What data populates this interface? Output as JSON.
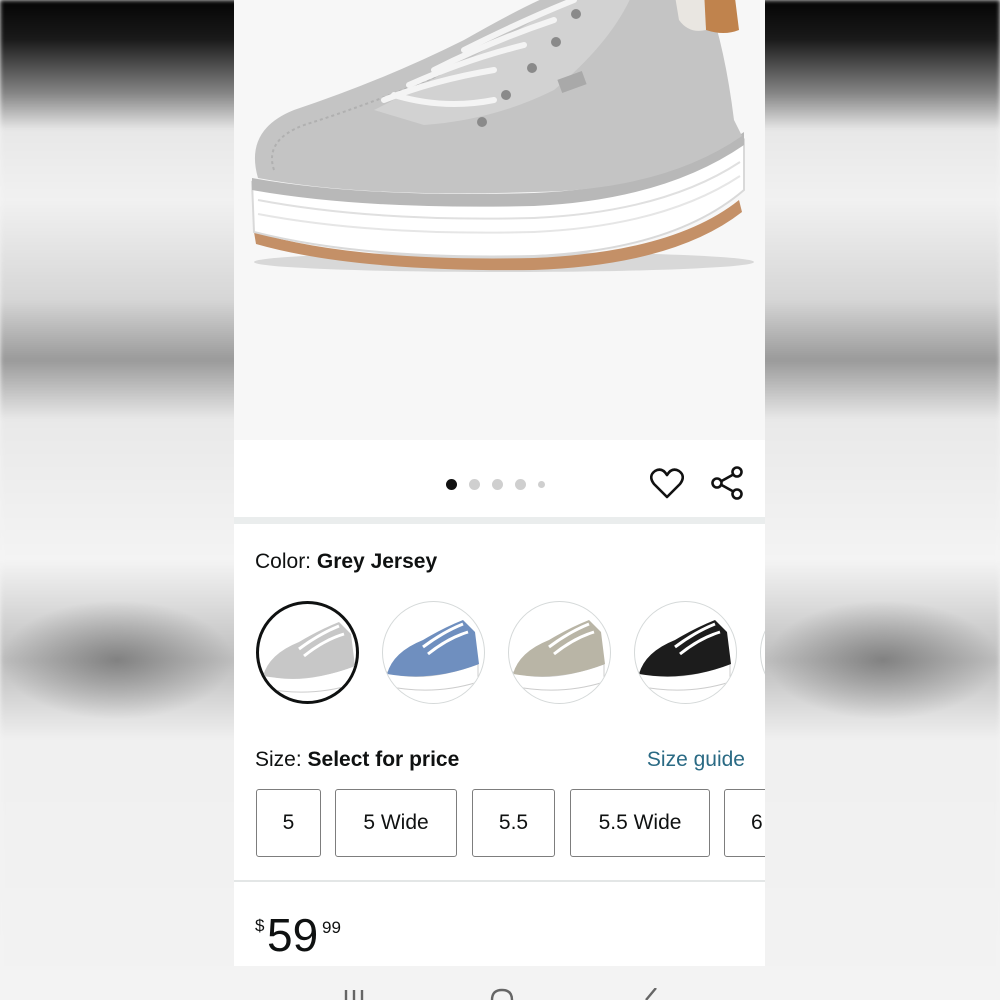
{
  "product": {
    "image_dots": {
      "count": 5,
      "active_index": 0
    }
  },
  "color": {
    "label": "Color:",
    "selected": "Grey Jersey",
    "swatches": [
      {
        "name": "grey-jersey",
        "shoe_color": "#c9c9c9",
        "selected": true
      },
      {
        "name": "blue",
        "shoe_color": "#6f8fbf",
        "selected": false
      },
      {
        "name": "taupe",
        "shoe_color": "#b9b5a6",
        "selected": false
      },
      {
        "name": "black",
        "shoe_color": "#1c1c1c",
        "selected": false
      },
      {
        "name": "partial-next",
        "shoe_color": "#cfcfcf",
        "selected": false
      }
    ]
  },
  "size": {
    "label": "Size:",
    "value": "Select for price",
    "guide_label": "Size guide",
    "options": [
      "5",
      "5 Wide",
      "5.5",
      "5.5 Wide",
      "6"
    ]
  },
  "price": {
    "currency": "$",
    "whole": "59",
    "fraction": "99"
  },
  "icons": {
    "favorite": "heart-icon",
    "share": "share-icon"
  },
  "colors": {
    "link": "#2a6a84",
    "text": "#0f1111",
    "selected_border": "#0f1111"
  }
}
